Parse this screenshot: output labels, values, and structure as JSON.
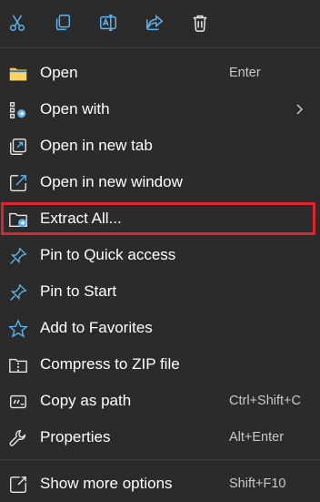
{
  "colors": {
    "background": "#2b2b2b",
    "text": "#ffffff",
    "shortcut_text": "#c8c8c8",
    "icon_blue": "#5bb4f0",
    "folder_yellow": "#f3c13a",
    "highlight_red": "#e0242b"
  },
  "toolbar": {
    "buttons": [
      {
        "name": "cut-icon"
      },
      {
        "name": "copy-icon"
      },
      {
        "name": "rename-icon"
      },
      {
        "name": "share-icon"
      },
      {
        "name": "delete-icon"
      }
    ]
  },
  "menu": {
    "items": [
      {
        "label": "Open",
        "shortcut": "Enter",
        "icon": "folder-icon"
      },
      {
        "label": "Open with",
        "shortcut": "",
        "icon": "open-with-icon",
        "submenu": true
      },
      {
        "label": "Open in new tab",
        "shortcut": "",
        "icon": "new-tab-icon"
      },
      {
        "label": "Open in new window",
        "shortcut": "",
        "icon": "new-window-icon"
      },
      {
        "label": "Extract All...",
        "shortcut": "",
        "icon": "extract-folder-icon",
        "highlighted": true
      },
      {
        "label": "Pin to Quick access",
        "shortcut": "",
        "icon": "pin-icon"
      },
      {
        "label": "Pin to Start",
        "shortcut": "",
        "icon": "pin-start-icon"
      },
      {
        "label": "Add to Favorites",
        "shortcut": "",
        "icon": "star-icon"
      },
      {
        "label": "Compress to ZIP file",
        "shortcut": "",
        "icon": "zip-folder-icon"
      },
      {
        "label": "Copy as path",
        "shortcut": "Ctrl+Shift+C",
        "icon": "copy-path-icon"
      },
      {
        "label": "Properties",
        "shortcut": "Alt+Enter",
        "icon": "wrench-icon"
      },
      {
        "label": "Show more options",
        "shortcut": "Shift+F10",
        "icon": "more-options-icon"
      }
    ]
  }
}
